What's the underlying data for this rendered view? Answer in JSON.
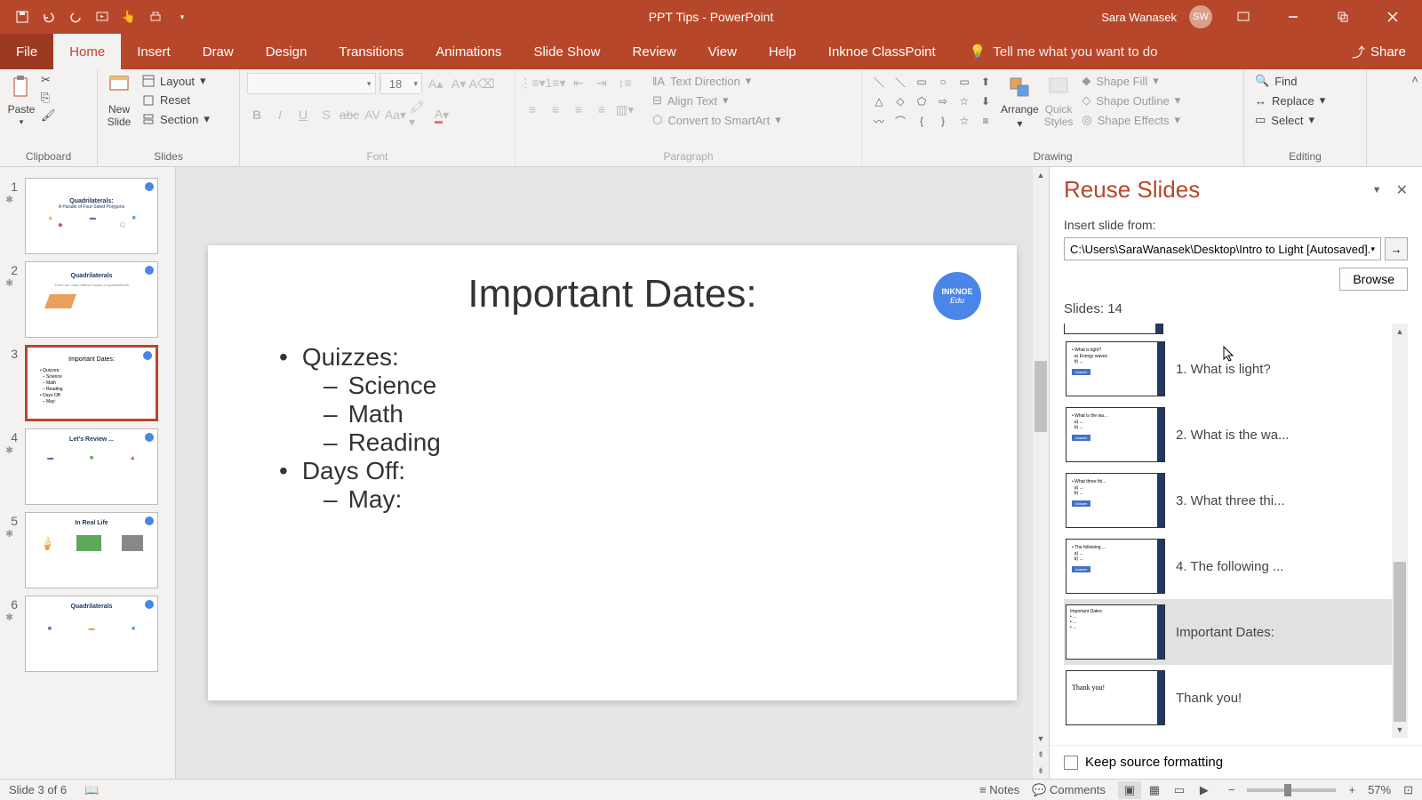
{
  "titlebar": {
    "title": "PPT Tips  -  PowerPoint",
    "user_name": "Sara Wanasek",
    "user_initials": "SW"
  },
  "tabs": {
    "file": "File",
    "home": "Home",
    "insert": "Insert",
    "draw": "Draw",
    "design": "Design",
    "transitions": "Transitions",
    "animations": "Animations",
    "slideshow": "Slide Show",
    "review": "Review",
    "view": "View",
    "help": "Help",
    "inknoe": "Inknoe ClassPoint",
    "tellme": "Tell me what you want to do",
    "share": "Share"
  },
  "ribbon": {
    "clipboard": {
      "paste": "Paste",
      "label": "Clipboard"
    },
    "slides": {
      "new_slide": "New\nSlide",
      "layout": "Layout",
      "reset": "Reset",
      "section": "Section",
      "label": "Slides"
    },
    "font": {
      "size": "18",
      "label": "Font"
    },
    "paragraph": {
      "text_direction": "Text Direction",
      "align_text": "Align Text",
      "convert": "Convert to SmartArt",
      "label": "Paragraph"
    },
    "drawing": {
      "arrange": "Arrange",
      "quick_styles": "Quick\nStyles",
      "shape_fill": "Shape Fill",
      "shape_outline": "Shape Outline",
      "shape_effects": "Shape Effects",
      "label": "Drawing"
    },
    "editing": {
      "find": "Find",
      "replace": "Replace",
      "select": "Select",
      "label": "Editing"
    }
  },
  "thumbnails": [
    {
      "num": "1",
      "title": "Quadrilaterals:"
    },
    {
      "num": "2",
      "title": "Quadrilaterals"
    },
    {
      "num": "3",
      "title": "Important Dates:"
    },
    {
      "num": "4",
      "title": "Let's Review ..."
    },
    {
      "num": "5",
      "title": "In Real Life"
    },
    {
      "num": "6",
      "title": "Quadrilaterals"
    }
  ],
  "slide": {
    "title": "Important Dates:",
    "items": [
      {
        "level": 1,
        "text": "Quizzes:"
      },
      {
        "level": 2,
        "text": "Science"
      },
      {
        "level": 2,
        "text": "Math"
      },
      {
        "level": 2,
        "text": "Reading"
      },
      {
        "level": 1,
        "text": "Days Off:"
      },
      {
        "level": 2,
        "text": "May:"
      }
    ],
    "badge": "INKNOE",
    "badge2": "Edu"
  },
  "reuse": {
    "title": "Reuse Slides",
    "insert_from": "Insert slide from:",
    "path": "C:\\Users\\SaraWanasek\\Desktop\\Intro to Light [Autosaved].",
    "browse": "Browse",
    "count": "Slides: 14",
    "items": [
      {
        "label": "1. What is light?"
      },
      {
        "label": "2. What is the wa..."
      },
      {
        "label": "3. What three thi..."
      },
      {
        "label": "4. The following ..."
      },
      {
        "label": "Important Dates:"
      },
      {
        "label": "Thank you!"
      }
    ],
    "keep_formatting": "Keep source formatting"
  },
  "status": {
    "slide_info": "Slide 3 of 6",
    "notes": "Notes",
    "comments": "Comments",
    "zoom": "57%"
  }
}
